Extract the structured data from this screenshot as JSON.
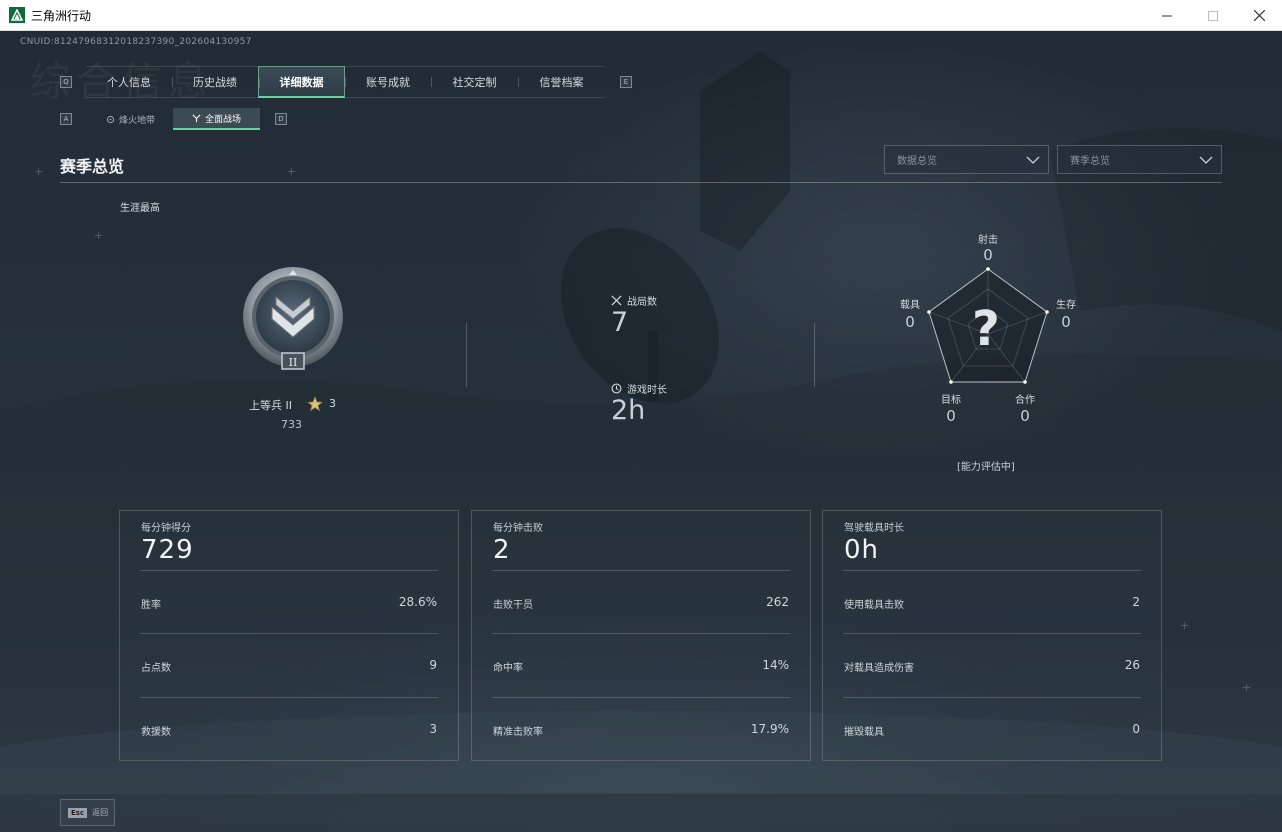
{
  "window": {
    "title": "三角洲行动",
    "minimize_icon": "minimize-icon",
    "maximize_icon": "maximize-icon",
    "close_icon": "close-icon"
  },
  "uid": "CNUID:8124796831201823739​0_202604130957",
  "background_title": "综合信息",
  "tabs": {
    "prev_key": "Q",
    "next_key": "E",
    "items": [
      {
        "label": "个人信息"
      },
      {
        "label": "历史战绩"
      },
      {
        "label": "详细数据",
        "active": true
      },
      {
        "label": "账号成就"
      },
      {
        "label": "社交定制"
      },
      {
        "label": "信誉档案"
      }
    ]
  },
  "subtabs": {
    "prev_key": "A",
    "next_key": "D",
    "items": [
      {
        "label": "烽火地带"
      },
      {
        "label": "全面战场",
        "active": true
      }
    ]
  },
  "section": {
    "title": "赛季总览",
    "dropdown_data": "数据总览",
    "dropdown_season": "赛季总览"
  },
  "career": {
    "label": "生涯最高",
    "rank_name": "上等兵 II",
    "rank_numeral": "II",
    "stars": "3",
    "points": "733"
  },
  "summary": {
    "matches_label": "战局数",
    "matches_value": "7",
    "playtime_label": "游戏时长",
    "playtime_value": "2h"
  },
  "radar": {
    "top_label": "射击",
    "top_value": "0",
    "right_label": "生存",
    "right_value": "0",
    "bottom_right_label": "合作",
    "bottom_right_value": "0",
    "bottom_left_label": "目标",
    "bottom_left_value": "0",
    "left_label": "载具",
    "left_value": "0",
    "center": "?",
    "status": "[能力评估中]"
  },
  "panels": [
    {
      "title": "每分钟得分",
      "big": "729",
      "rows": [
        {
          "label": "胜率",
          "value": "28.6%"
        },
        {
          "label": "占点数",
          "value": "9"
        },
        {
          "label": "救援数",
          "value": "3"
        }
      ]
    },
    {
      "title": "每分钟击败",
      "big": "2",
      "rows": [
        {
          "label": "击败干员",
          "value": "262"
        },
        {
          "label": "命中率",
          "value": "14%"
        },
        {
          "label": "精准击败率",
          "value": "17.9%"
        }
      ]
    },
    {
      "title": "驾驶载具时长",
      "big": "0h",
      "rows": [
        {
          "label": "使用载具击败",
          "value": "2"
        },
        {
          "label": "对载具造成伤害",
          "value": "26"
        },
        {
          "label": "摧毁载具",
          "value": "0"
        }
      ]
    }
  ],
  "bottom": {
    "esc_key": "Esc",
    "esc_label": "返回"
  },
  "colors": {
    "accent_green": "#63d39f",
    "background": "#1f2731"
  }
}
